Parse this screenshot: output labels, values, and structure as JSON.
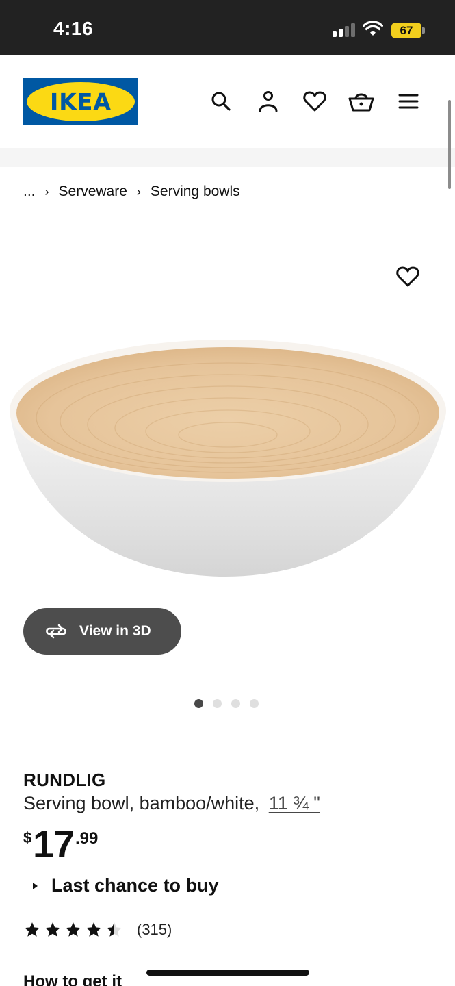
{
  "status_bar": {
    "time": "4:16",
    "battery": "67"
  },
  "header": {
    "logo_text": "IKEA"
  },
  "breadcrumb": {
    "ellipsis": "...",
    "items": [
      "Serveware",
      "Serving bowls"
    ]
  },
  "gallery": {
    "view_3d_label": "View in 3D",
    "image_count": 4,
    "active_index": 0
  },
  "product": {
    "name": "RUNDLIG",
    "description": "Serving bowl, bamboo/white,",
    "size": "11 ¾ \"",
    "price_currency": "$",
    "price_integer": "17",
    "price_decimal": ".99",
    "availability": "Last chance to buy",
    "rating_value": 4.5,
    "rating_max": 5,
    "review_count": "(315)"
  },
  "sections": {
    "how_to_get_it": "How to get it"
  },
  "colors": {
    "ikea_blue": "#0058a3",
    "ikea_yellow": "#fbd914",
    "status_bar_bg": "#222222",
    "button_bg": "#4d4d4d"
  },
  "icons": {
    "search": "search-icon",
    "account": "user-icon",
    "favourites": "heart-icon",
    "cart": "shopping-basket-icon",
    "menu": "hamburger-menu-icon",
    "view_3d": "rotate-3d-icon"
  }
}
